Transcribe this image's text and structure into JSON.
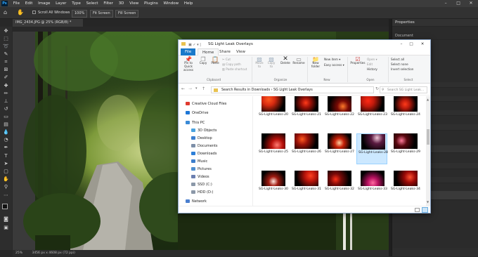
{
  "photoshop": {
    "logo": "Ps",
    "menu": [
      "File",
      "Edit",
      "Image",
      "Layer",
      "Type",
      "Select",
      "Filter",
      "3D",
      "View",
      "Plugins",
      "Window",
      "Help"
    ],
    "window_controls": {
      "minimize": "–",
      "maximize": "□",
      "close": "✕"
    },
    "options": {
      "scroll_all": "Scroll All Windows",
      "zoom_100": "100%",
      "fit_screen": "Fit Screen",
      "fill_screen": "Fill Screen"
    },
    "document_tab": "IMG_2434.JPG @ 25% (RGB/8) *",
    "status": {
      "zoom": "25%",
      "info": "3456 px x 4608 px (72 ppi)"
    },
    "panel": {
      "title": "Properties",
      "subtitle": "Document"
    },
    "icons": [
      "home-icon",
      "hand-icon",
      "move-icon",
      "marquee-icon",
      "lasso-icon",
      "magic-wand-icon",
      "crop-icon",
      "eyedropper-icon",
      "healing-icon",
      "brush-icon",
      "stamp-icon",
      "history-brush-icon",
      "eraser-icon",
      "gradient-icon",
      "blur-icon",
      "dodge-icon",
      "pen-icon",
      "type-icon",
      "path-select-icon",
      "shape-icon",
      "hand-tool-icon",
      "zoom-icon"
    ]
  },
  "explorer": {
    "title": "SG Light Leak Overlays",
    "window_controls": {
      "minimize": "–",
      "maximize": "□",
      "close": "✕"
    },
    "tabs": [
      "File",
      "Home",
      "Share",
      "View"
    ],
    "ribbon": {
      "pin": "Pin to Quick access",
      "copy": "Copy",
      "paste": "Paste",
      "cut": "Cut",
      "copy_path": "Copy path",
      "paste_shortcut": "Paste shortcut",
      "move_to": "Move to",
      "copy_to": "Copy to",
      "delete": "Delete",
      "rename": "Rename",
      "new_folder": "New folder",
      "new_item": "New item ▾",
      "easy_access": "Easy access ▾",
      "properties": "Properties",
      "open": "Open ▾",
      "edit": "Edit",
      "history": "History",
      "select_all": "Select all",
      "select_none": "Select none",
      "invert_selection": "Invert selection",
      "groups": {
        "clipboard": "Clipboard",
        "organize": "Organize",
        "new": "New",
        "open": "Open",
        "select": "Select"
      }
    },
    "address": {
      "crumbs": "Search Results in Downloads  ›  SG Light Leak Overlays",
      "search_placeholder": "Search SG Light Leak..."
    },
    "nav": [
      {
        "label": "Creative Cloud Files",
        "color": "#e03a2f"
      },
      {
        "label": "OneDrive",
        "color": "#1e76d6"
      },
      {
        "label": "This PC",
        "color": "#3a8ad6"
      },
      {
        "label": "3D Objects",
        "color": "#4aa3df"
      },
      {
        "label": "Desktop",
        "color": "#3b7fd0"
      },
      {
        "label": "Documents",
        "color": "#7d8fa8"
      },
      {
        "label": "Downloads",
        "color": "#2d7fd8"
      },
      {
        "label": "Music",
        "color": "#3d7fcc"
      },
      {
        "label": "Pictures",
        "color": "#4f8fcf"
      },
      {
        "label": "Videos",
        "color": "#6b7fb0"
      },
      {
        "label": "SSD (C:)",
        "color": "#8b98a8"
      },
      {
        "label": "HDD (D:)",
        "color": "#8b98a8"
      },
      {
        "label": "Network",
        "color": "#4a7fcf"
      }
    ],
    "thumbs": [
      {
        "label": "SG-Light-Leaks-20",
        "color": "#d72a10",
        "spot": "#ff5a20"
      },
      {
        "label": "SG-Light-Leaks-21",
        "color": "#a01208",
        "spot": "#ff3b1a"
      },
      {
        "label": "SG-Light-Leaks-22",
        "color": "#7a0a05",
        "spot": "#ff7a2a"
      },
      {
        "label": "SG-Light-Leaks-23",
        "color": "#c11a0c",
        "spot": "#ff2a14"
      },
      {
        "label": "SG-Light-Leaks-24",
        "color": "#b81a0c",
        "spot": "#ff3a1a"
      },
      {
        "label": "SG-Light-Leaks-25",
        "color": "#b8100a",
        "spot": "#ff7a70"
      },
      {
        "label": "SG-Light-Leaks-26",
        "color": "#9a1208",
        "spot": "#ff5a20"
      },
      {
        "label": "SG-Light-Leaks-27",
        "color": "#c82008",
        "spot": "#ffd0a0"
      },
      {
        "label": "SG-Light-Leaks-28",
        "color": "#5a1a40",
        "spot": "#f0c8d8"
      },
      {
        "label": "SG-Light-Leaks-29",
        "color": "#5a0810",
        "spot": "#ff7a9a"
      },
      {
        "label": "SG-Light-Leaks-30",
        "color": "#a01a10",
        "spot": "#ffe8e0"
      },
      {
        "label": "SG-Light-Leaks-31",
        "color": "#b8140a",
        "spot": "#ff4020"
      },
      {
        "label": "SG-Light-Leaks-32",
        "color": "#7a0a08",
        "spot": "#ff3018"
      },
      {
        "label": "SG-Light-Leaks-33",
        "color": "#b81060",
        "spot": "#ff6aa0"
      },
      {
        "label": "SG-Light-Leaks-34",
        "color": "#9a0a08",
        "spot": "#ff5030"
      }
    ],
    "selected_index": 8
  }
}
